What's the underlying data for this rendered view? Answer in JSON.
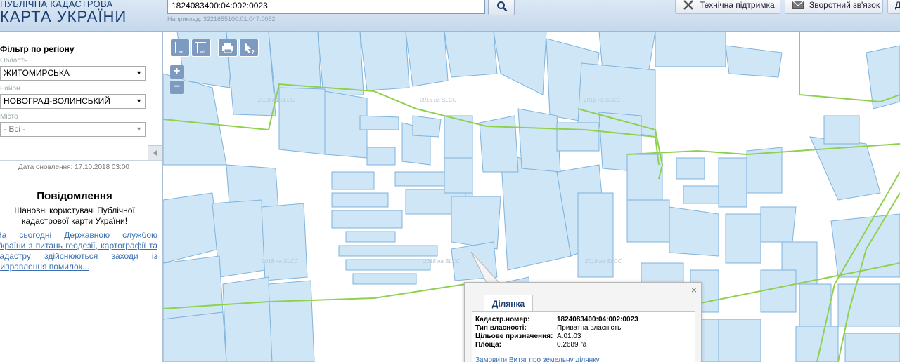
{
  "header": {
    "logo_top": "ПУБЛІЧНА КАДАСТРОВА",
    "logo_main": "КАРТА УКРАЇНИ",
    "search_value": "1824083400:04:002:0023",
    "search_hint": "Наприклад: 3221655100:01:047:0052",
    "support_label": "Технічна підтримка",
    "feedback_label": "Зворотний зв'язок",
    "extra_label": "Д"
  },
  "sidebar": {
    "filter_title": "Фільтр по регіону",
    "region_label": "Область",
    "region_value": "ЖИТОМИРСЬКА",
    "district_label": "Район",
    "district_value": "НОВОГРАД-ВОЛИНСЬКИЙ",
    "city_label": "Місто",
    "city_value": "- Всі -",
    "update_text": "Дата оновлення: 17.10.2018 03:00",
    "notice_title": "Повідомлення",
    "notice_body": "Шановні користувачі Публічної кадастрової карти України!",
    "notice_link": "На сьогодні Державною службою України з питань геодезії, картографії та кадастру здійснюються заходи із виправлення помилок..."
  },
  "map": {
    "zoom_in": "+",
    "zoom_out": "−",
    "watermark": "2018 на SLCC",
    "parcel_fill": "#cfe6f7",
    "parcel_stroke": "#7fb3dc",
    "boundary_color": "#8fd14f"
  },
  "popup": {
    "close": "×",
    "tab_label": "Ділянка",
    "rows": [
      {
        "label": "Кадастр.номер:",
        "value": "1824083400:04:002:0023"
      },
      {
        "label": "Тип власності:",
        "value": "Приватна власність"
      },
      {
        "label": "Цільове призначення:",
        "value": "А.01.03"
      },
      {
        "label": "Площа:",
        "value": "0.2689 га"
      }
    ],
    "link": "Замовити Витяг про земельну ділянку"
  }
}
